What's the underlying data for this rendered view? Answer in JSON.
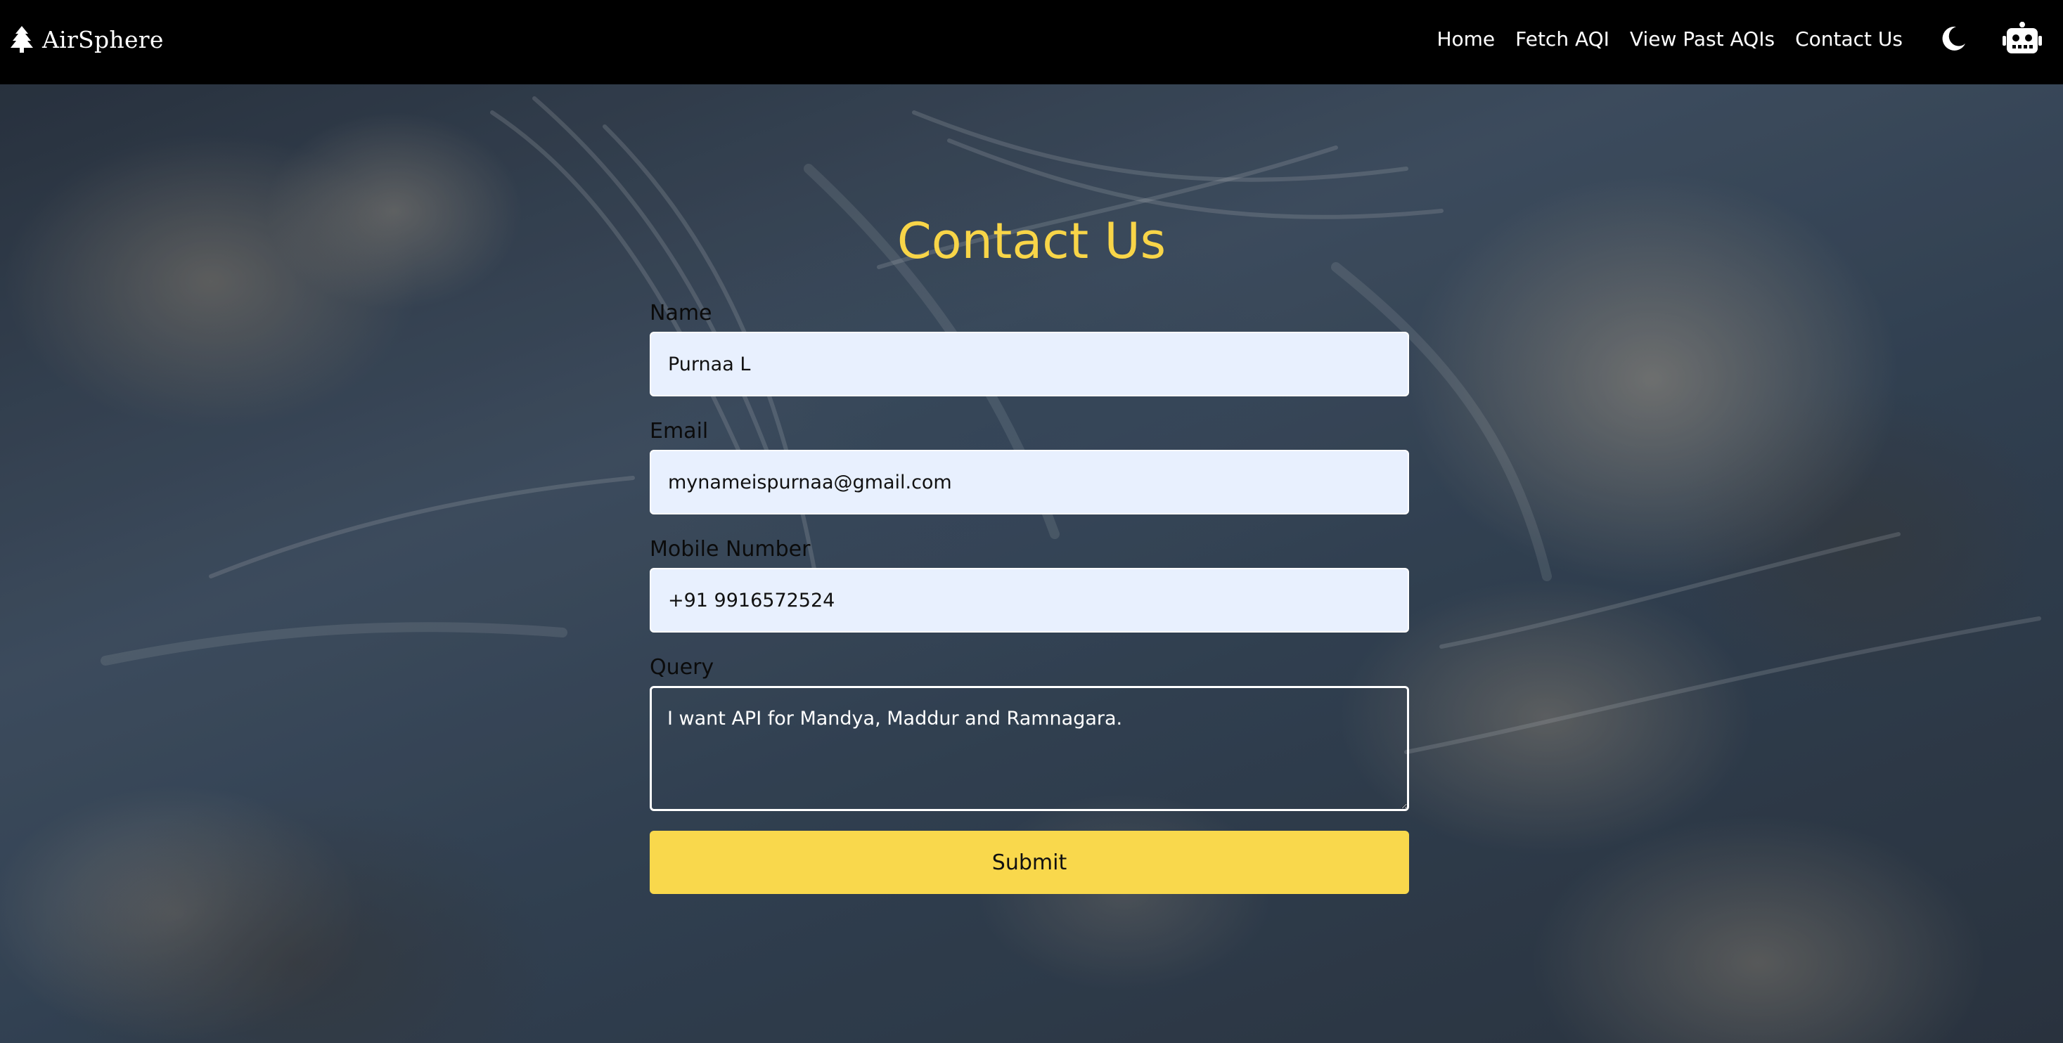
{
  "brand": {
    "name": "AirSphere",
    "icon": "tree-icon"
  },
  "nav": {
    "items": [
      {
        "label": "Home"
      },
      {
        "label": "Fetch AQI"
      },
      {
        "label": "View Past AQIs"
      },
      {
        "label": "Contact Us"
      }
    ],
    "theme_toggle_icon": "moon-icon",
    "chatbot_icon": "robot-icon"
  },
  "contact": {
    "title": "Contact Us",
    "fields": {
      "name": {
        "label": "Name",
        "value": "Purnaa L"
      },
      "email": {
        "label": "Email",
        "value": "mynameispurnaa@gmail.com"
      },
      "mobile": {
        "label": "Mobile Number",
        "value": "+91 9916572524"
      },
      "query": {
        "label": "Query",
        "value": "I want API for Mandya, Maddur and Ramnagara."
      }
    },
    "submit_label": "Submit"
  },
  "colors": {
    "accent": "#f8d548",
    "navbar": "#000000",
    "input_bg": "#e8f0fe"
  }
}
